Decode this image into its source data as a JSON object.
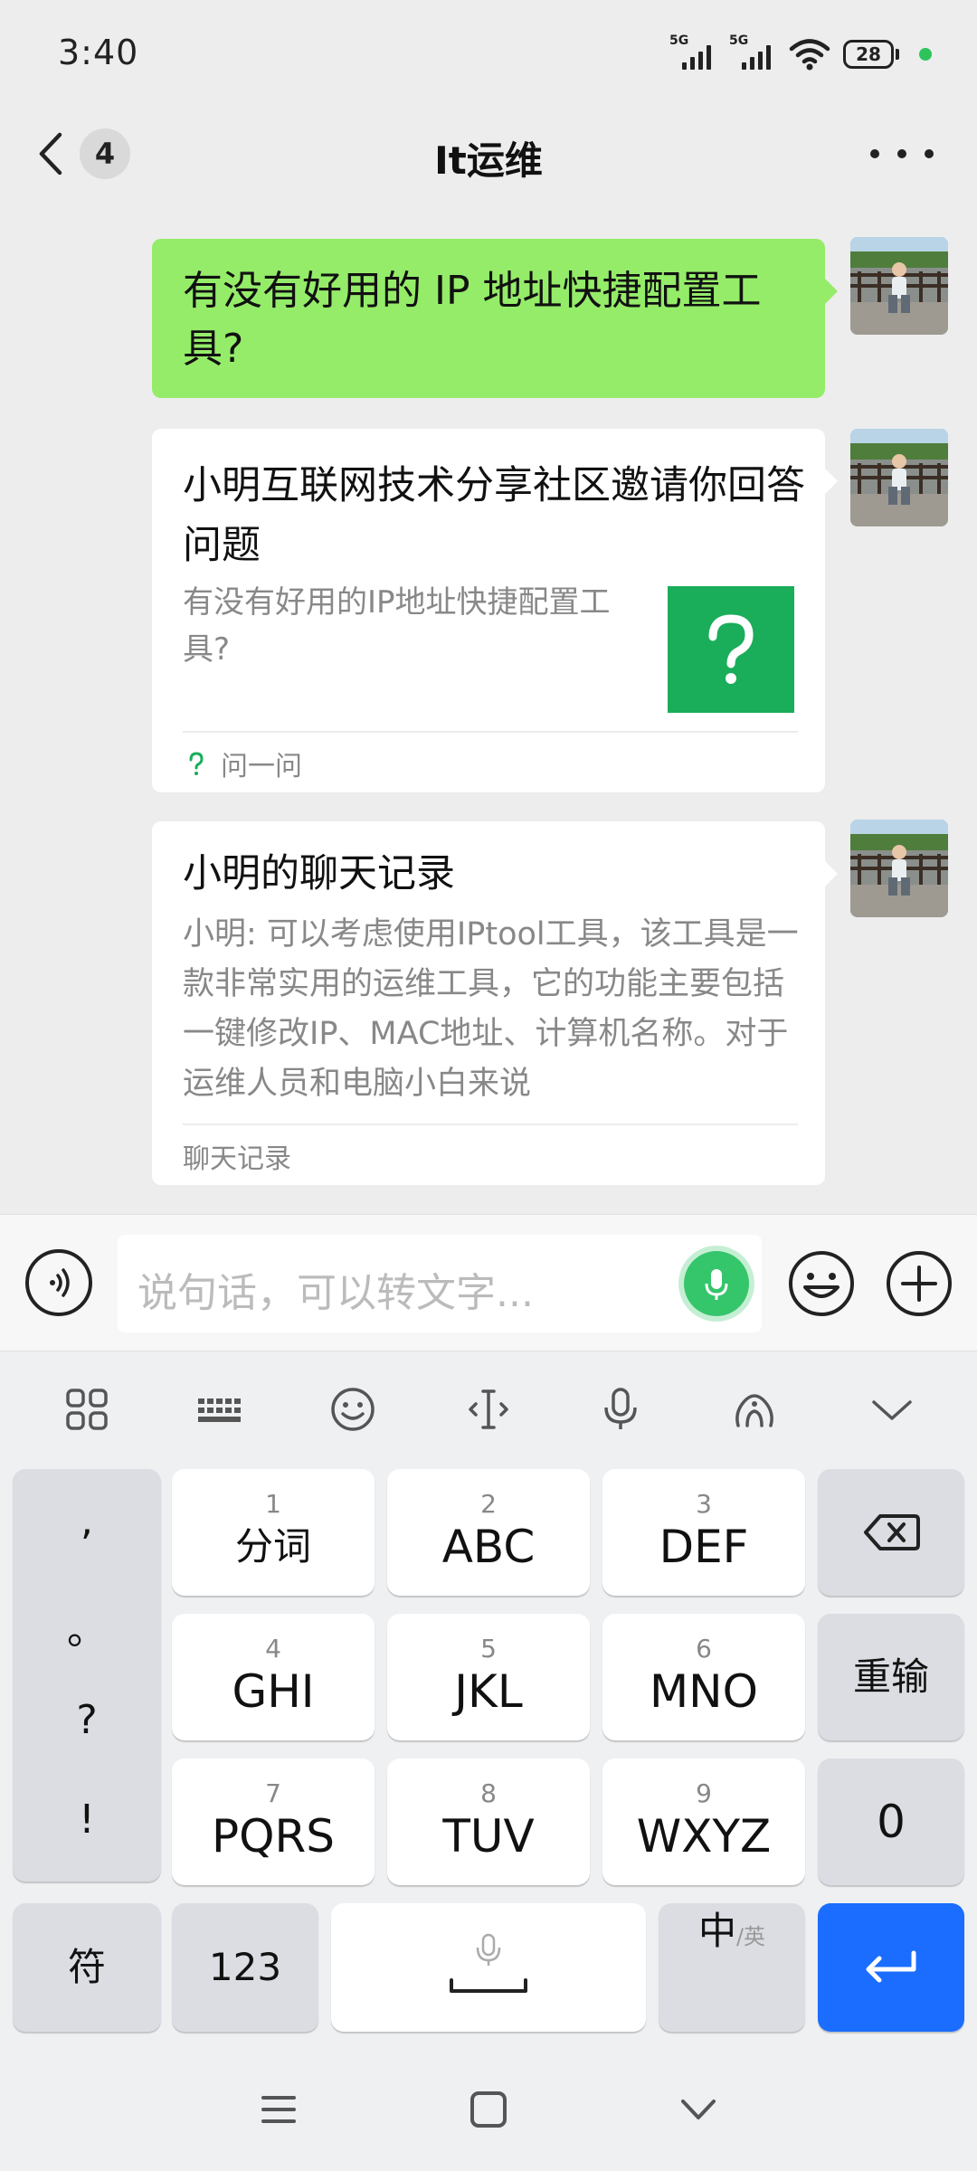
{
  "status_bar": {
    "time": "3:40",
    "signal1_label": "5G",
    "signal2_label": "5G",
    "battery": "28",
    "icons": [
      "signal-5g-icon",
      "signal-5g-icon",
      "wifi-icon",
      "battery-icon"
    ]
  },
  "header": {
    "unread_count": "4",
    "title": "It运维",
    "icons": [
      "chevron-left-icon",
      "more-icon"
    ]
  },
  "messages": [
    {
      "type": "text",
      "text": "有没有好用的 IP 地址快捷配置工具?"
    },
    {
      "type": "question-card",
      "title": "小明互联网技术分享社区邀请你回答问题",
      "description": "有没有好用的IP地址快捷配置工具?",
      "footer": "问一问"
    },
    {
      "type": "chat-record-card",
      "title": "小明的聊天记录",
      "description": "小明: 可以考虑使用IPtool工具，该工具是一款非常实用的运维工具，它的功能主要包括一键修改IP、MAC地址、计算机名称。对于运维人员和电脑小白来说",
      "footer": "聊天记录"
    }
  ],
  "input_bar": {
    "placeholder": "说句话，可以转文字...",
    "icons": [
      "voice-icon",
      "mic-icon",
      "emoji-icon",
      "plus-icon"
    ]
  },
  "keyboard": {
    "toolbar_icons": [
      "grid-icon",
      "keyboard-icon",
      "emoji-icon",
      "cursor-icon",
      "mic-icon",
      "handwriting-icon",
      "collapse-icon"
    ],
    "punctuation": [
      ",",
      "。",
      "?",
      "!"
    ],
    "keys": [
      {
        "num": "1",
        "label": "分词"
      },
      {
        "num": "2",
        "label": "ABC"
      },
      {
        "num": "3",
        "label": "DEF"
      },
      {
        "num": "4",
        "label": "GHI"
      },
      {
        "num": "5",
        "label": "JKL"
      },
      {
        "num": "6",
        "label": "MNO"
      },
      {
        "num": "7",
        "label": "PQRS"
      },
      {
        "num": "8",
        "label": "TUV"
      },
      {
        "num": "9",
        "label": "WXYZ"
      }
    ],
    "backspace_icon": "backspace-icon",
    "reenter": "重输",
    "zero": "0",
    "symbols": "符",
    "numbers": "123",
    "lang_main": "中",
    "lang_sub": "/英",
    "enter_icon": "enter-icon",
    "accent_color": "#1a6dff"
  },
  "nav_bar": {
    "icons": [
      "menu-icon",
      "home-icon",
      "back-icon"
    ]
  }
}
